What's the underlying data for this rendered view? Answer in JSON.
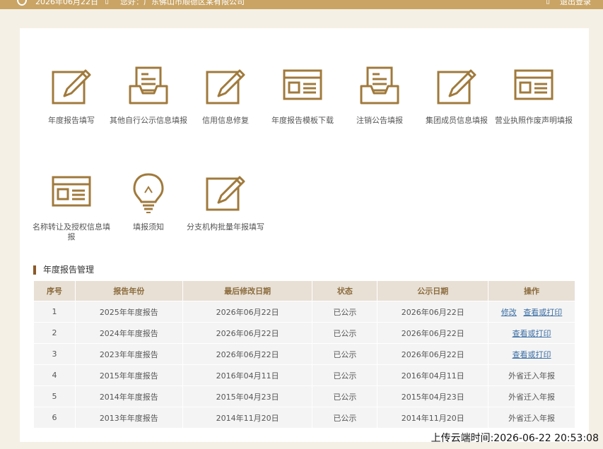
{
  "topbar": {
    "date_text": "2026年06月22日",
    "location_text": "您好：广东佛山市顺德区某有限公司",
    "logout_label": "退出登录"
  },
  "tiles": [
    {
      "label": "年度报告填写",
      "icon": "edit-icon"
    },
    {
      "label": "其他自行公示信息填报",
      "icon": "inbox-icon"
    },
    {
      "label": "信用信息修复",
      "icon": "edit-icon"
    },
    {
      "label": "年度报告模板下载",
      "icon": "browser-window-icon"
    },
    {
      "label": "注销公告填报",
      "icon": "inbox-icon"
    },
    {
      "label": "集团成员信息填报",
      "icon": "edit-icon"
    },
    {
      "label": "营业执照作废声明填报",
      "icon": "browser-window-icon"
    },
    {
      "label": "名称转让及授权信息填报",
      "icon": "browser-window-icon"
    },
    {
      "label": "填报须知",
      "icon": "lightbulb-icon"
    },
    {
      "label": "分支机构批量年报填写",
      "icon": "edit-icon"
    }
  ],
  "section_title": "年度报告管理",
  "table": {
    "headers": [
      "序号",
      "报告年份",
      "最后修改日期",
      "状态",
      "公示日期",
      "操作"
    ],
    "rows": [
      {
        "no": "1",
        "year": "2025年年度报告",
        "modified": "2026年06月22日",
        "status": "已公示",
        "published": "2026年06月22日",
        "actions": [
          "修改",
          "查看或打印"
        ]
      },
      {
        "no": "2",
        "year": "2024年年度报告",
        "modified": "2026年06月22日",
        "status": "已公示",
        "published": "2026年06月22日",
        "actions": [
          "查看或打印"
        ]
      },
      {
        "no": "3",
        "year": "2023年年度报告",
        "modified": "2026年06月22日",
        "status": "已公示",
        "published": "2026年06月22日",
        "actions": [
          "查看或打印"
        ]
      },
      {
        "no": "4",
        "year": "2015年年度报告",
        "modified": "2016年04月11日",
        "status": "已公示",
        "published": "2016年04月11日",
        "note": "外省迁入年报"
      },
      {
        "no": "5",
        "year": "2014年年度报告",
        "modified": "2015年04月23日",
        "status": "已公示",
        "published": "2015年04月23日",
        "note": "外省迁入年报"
      },
      {
        "no": "6",
        "year": "2013年年度报告",
        "modified": "2014年11月20日",
        "status": "已公示",
        "published": "2014年11月20日",
        "note": "外省迁入年报"
      }
    ]
  },
  "footer_stamp": "上传云端时间:2026-06-22 20:53:08",
  "colors": {
    "accent": "#a07a3c",
    "topbar": "#c9a465",
    "link": "#3b6ea5"
  }
}
